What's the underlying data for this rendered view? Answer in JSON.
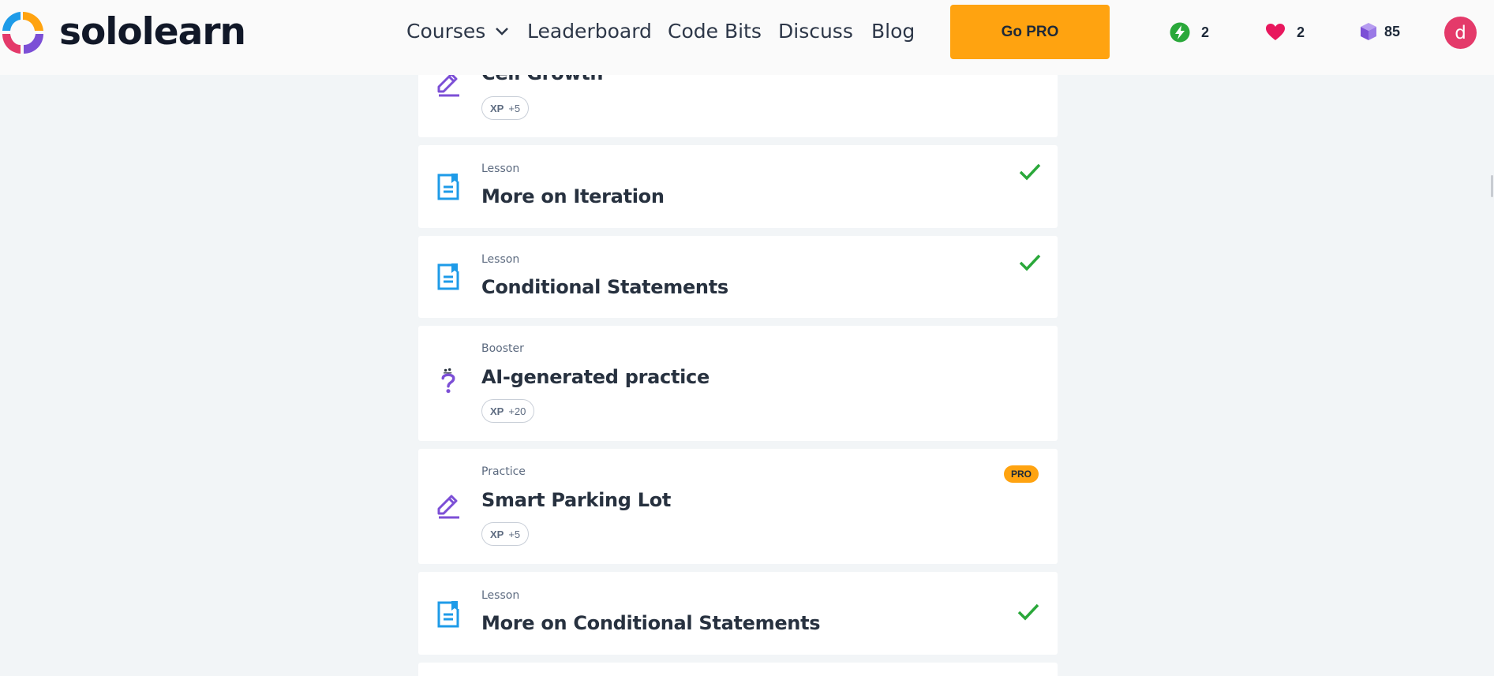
{
  "brand": {
    "name": "sololearn"
  },
  "nav": {
    "courses": "Courses",
    "leaderboard": "Leaderboard",
    "code_bits": "Code Bits",
    "discuss": "Discuss",
    "blog": "Blog"
  },
  "header": {
    "go_pro": "Go PRO",
    "streak_count": "2",
    "hearts_count": "2",
    "gems_count": "85",
    "avatar_letter": "d"
  },
  "colors": {
    "accent_orange": "#ffa310",
    "lesson_blue": "#1e9be8",
    "practice_purple": "#7c4fd6",
    "check_green": "#2aa83a",
    "avatar_pink": "#e43a6a"
  },
  "items": [
    {
      "type": "",
      "title": "Cell Growth",
      "xp_label": "XP",
      "xp": "+5",
      "icon": "pencil-icon"
    },
    {
      "type": "Lesson",
      "title": "More on Iteration",
      "icon": "lesson-icon",
      "completed": true
    },
    {
      "type": "Lesson",
      "title": "Conditional Statements",
      "icon": "lesson-icon",
      "completed": true
    },
    {
      "type": "Booster",
      "title": "AI-generated practice",
      "xp_label": "XP",
      "xp": "+20",
      "icon": "booster-icon"
    },
    {
      "type": "Practice",
      "title": "Smart Parking Lot",
      "xp_label": "XP",
      "xp": "+5",
      "icon": "pencil-icon",
      "badge": "PRO"
    },
    {
      "type": "Lesson",
      "title": "More on Conditional Statements",
      "icon": "lesson-icon",
      "completed": true
    }
  ]
}
